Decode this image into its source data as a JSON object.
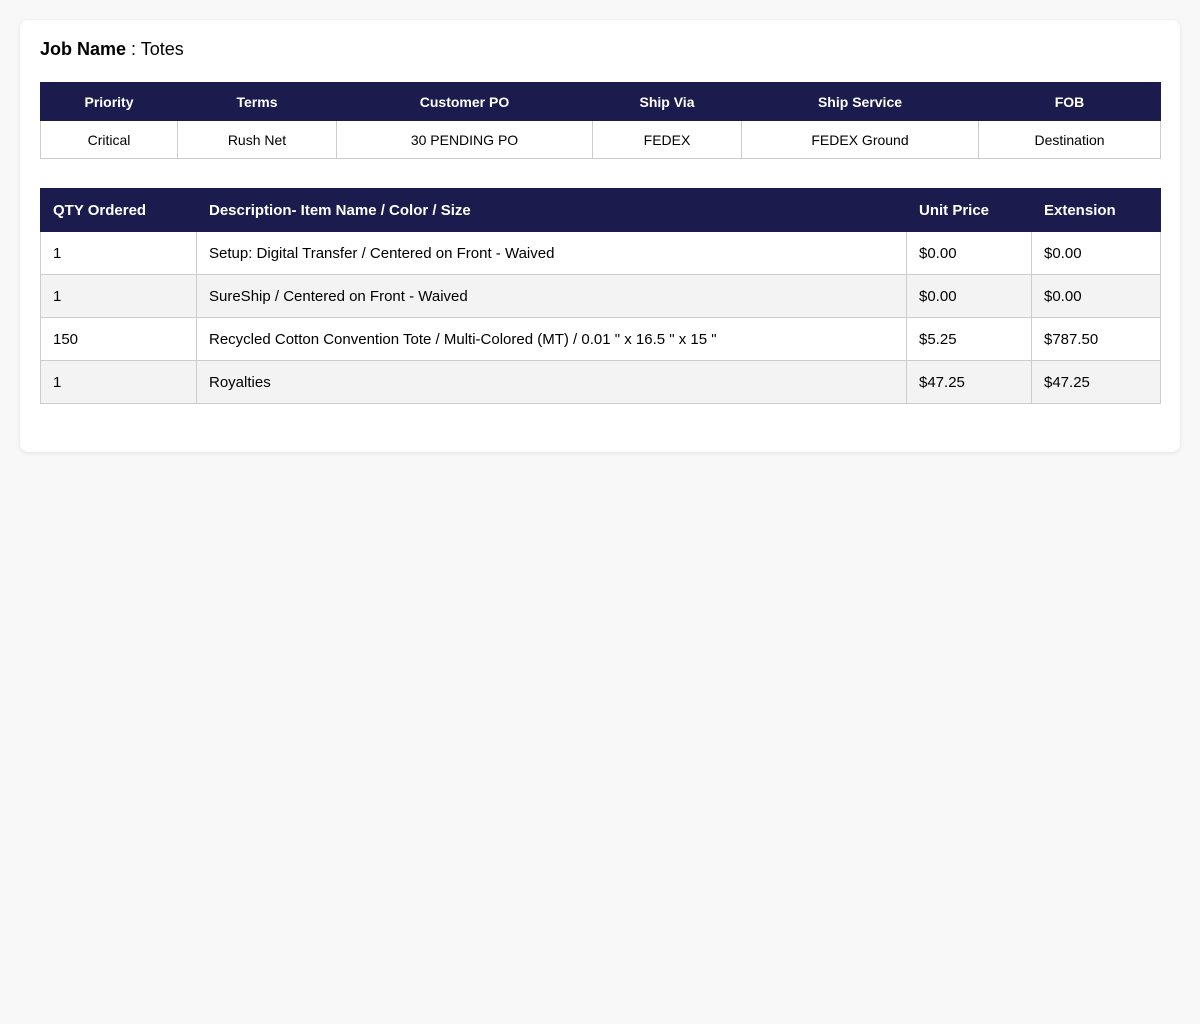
{
  "job": {
    "label": "Job Name",
    "separator": " : ",
    "value": "Totes"
  },
  "info": {
    "headers": [
      "Priority",
      "Terms",
      "Customer PO",
      "Ship Via",
      "Ship Service",
      "FOB"
    ],
    "values": [
      "Critical",
      "Rush Net",
      "30 PENDING PO",
      "FEDEX",
      "FEDEX Ground",
      "Destination"
    ]
  },
  "items": {
    "headers": [
      "QTY Ordered",
      "Description- Item Name / Color / Size",
      "Unit Price",
      "Extension"
    ],
    "rows": [
      [
        "1",
        "Setup: Digital Transfer / Centered on Front - Waived",
        "$0.00",
        "$0.00"
      ],
      [
        "1",
        "SureShip / Centered on Front - Waived",
        "$0.00",
        "$0.00"
      ],
      [
        "150",
        "Recycled Cotton Convention Tote / Multi-Colored (MT) / 0.01 \" x 16.5 \" x 15 \"",
        "$5.25",
        "$787.50"
      ],
      [
        "1",
        "Royalties",
        "$47.25",
        "$47.25"
      ]
    ]
  },
  "colors": {
    "header_bg": "#1b1b4d",
    "page_bg": "#f8f8f8"
  }
}
